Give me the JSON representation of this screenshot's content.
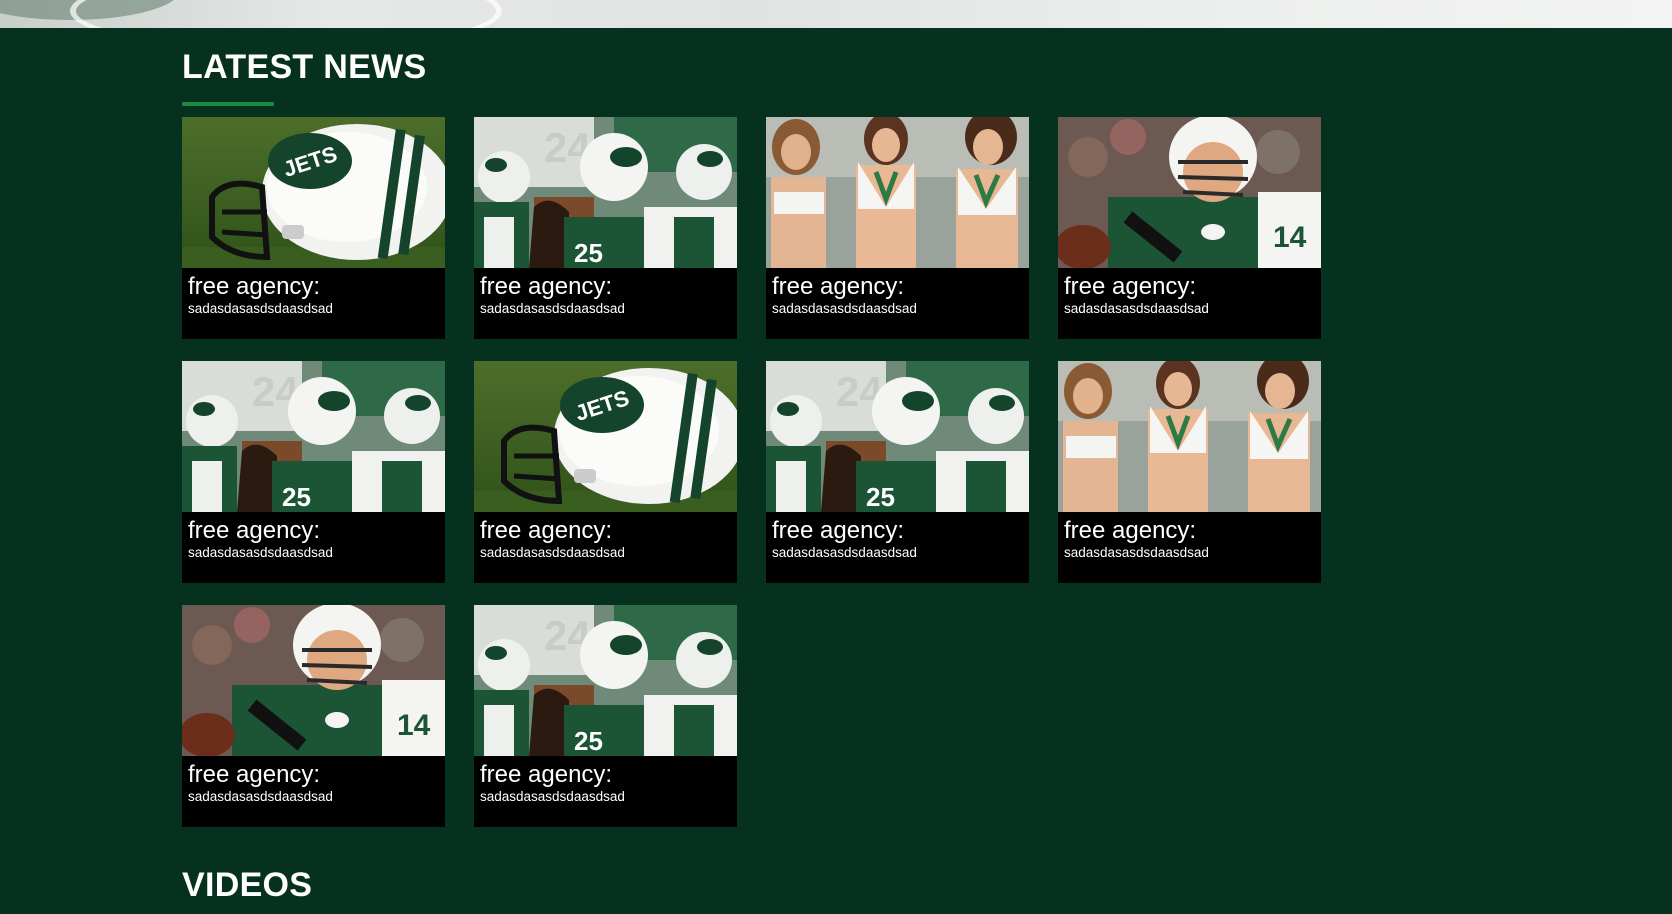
{
  "latest_news": {
    "title": "LATEST NEWS",
    "items": [
      {
        "image": "helmet",
        "headline": "free agency:",
        "subtitle": "sadasdasasdsdaasdsad"
      },
      {
        "image": "huddle",
        "headline": "free agency:",
        "subtitle": "sadasdasasdsdaasdsad"
      },
      {
        "image": "cheerleaders",
        "headline": "free agency:",
        "subtitle": "sadasdasasdsdaasdsad"
      },
      {
        "image": "quarterback",
        "headline": "free agency:",
        "subtitle": "sadasdasasdsdaasdsad"
      },
      {
        "image": "huddle",
        "headline": "free agency:",
        "subtitle": "sadasdasasdsdaasdsad"
      },
      {
        "image": "helmet",
        "headline": "free agency:",
        "subtitle": "sadasdasasdsdaasdsad"
      },
      {
        "image": "huddle",
        "headline": "free agency:",
        "subtitle": "sadasdasasdsdaasdsad"
      },
      {
        "image": "cheerleaders",
        "headline": "free agency:",
        "subtitle": "sadasdasasdsdaasdsad"
      },
      {
        "image": "quarterback",
        "headline": "free agency:",
        "subtitle": "sadasdasasdsdaasdsad"
      },
      {
        "image": "huddle",
        "headline": "free agency:",
        "subtitle": "sadasdasasdsdaasdsad"
      }
    ]
  },
  "videos": {
    "title": "VIDEOS"
  },
  "colors": {
    "page_background": "#06311e",
    "accent_underline": "#1d8a43",
    "card_background": "#000000",
    "text": "#ffffff"
  }
}
